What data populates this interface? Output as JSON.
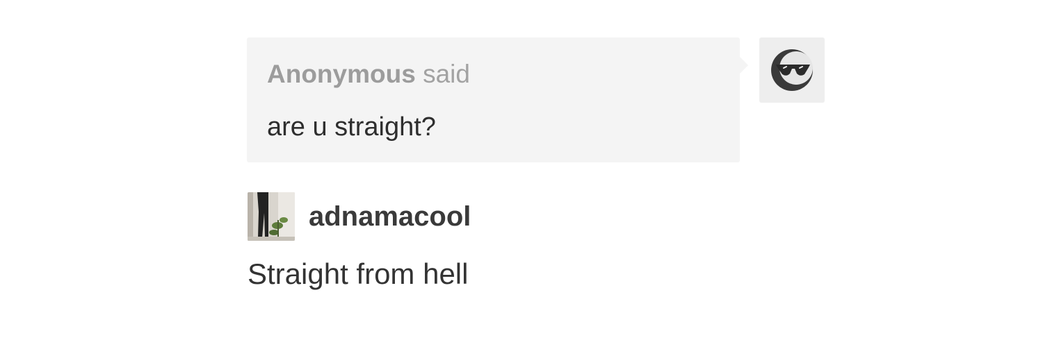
{
  "question": {
    "asker_name": "Anonymous",
    "asker_suffix": "said",
    "text": "are u straight?",
    "avatar_icon": "anonymous-sunglasses-icon"
  },
  "answer": {
    "answerer_name": "adnamacool",
    "text": "Straight from hell",
    "avatar_icon": "user-photo-avatar"
  },
  "colors": {
    "bubble_background": "#f4f4f4",
    "asker_text": "#a2a2a2",
    "body_text": "#333333"
  }
}
